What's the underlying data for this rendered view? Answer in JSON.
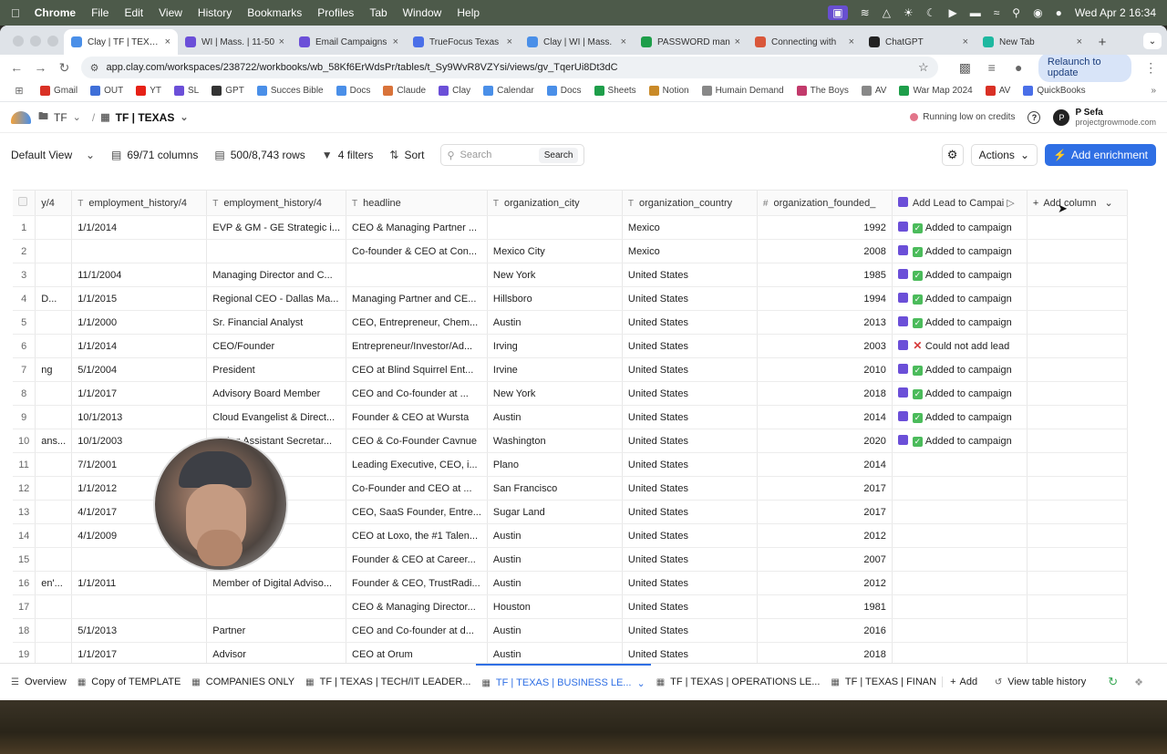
{
  "menubar": {
    "app": "Chrome",
    "items": [
      "File",
      "Edit",
      "View",
      "History",
      "Bookmarks",
      "Profiles",
      "Tab",
      "Window",
      "Help"
    ],
    "clock": "Wed Apr 2  16:34"
  },
  "browser": {
    "tabs": [
      {
        "label": "Clay | TF | TEXAS",
        "color": "#4a8fe8",
        "active": true
      },
      {
        "label": "WI | Mass. | 11-50",
        "color": "#6b4fd8"
      },
      {
        "label": "Email Campaigns",
        "color": "#6b4fd8"
      },
      {
        "label": "TrueFocus Texas",
        "color": "#4a6fe8"
      },
      {
        "label": "Clay | WI | Mass.",
        "color": "#4a8fe8"
      },
      {
        "label": "PASSWORD man",
        "color": "#1e9e4a"
      },
      {
        "label": "Connecting with",
        "color": "#d9573a"
      },
      {
        "label": "ChatGPT",
        "color": "#222222"
      },
      {
        "label": "New Tab",
        "color": "#1eb8a0"
      }
    ],
    "url": "app.clay.com/workspaces/238722/workbooks/wb_58Kf6ErWdsPr/tables/t_Sy9WvR8VZYsi/views/gv_TqerUi8Dt3dC",
    "relaunch": "Relaunch to update",
    "bookmarks": [
      {
        "label": "Gmail",
        "color": "#d93025"
      },
      {
        "label": "OUT",
        "color": "#3f6fd8"
      },
      {
        "label": "YT",
        "color": "#e62117"
      },
      {
        "label": "SL",
        "color": "#6b4fd8"
      },
      {
        "label": "GPT",
        "color": "#333333"
      },
      {
        "label": "Succes Bible",
        "color": "#4a8fe8"
      },
      {
        "label": "Docs",
        "color": "#4a8fe8"
      },
      {
        "label": "Claude",
        "color": "#d9733a"
      },
      {
        "label": "Clay",
        "color": "#6b4fd8"
      },
      {
        "label": "Calendar",
        "color": "#4a8fe8"
      },
      {
        "label": "Docs",
        "color": "#4a8fe8"
      },
      {
        "label": "Sheets",
        "color": "#1e9e4a"
      },
      {
        "label": "Notion",
        "color": "#c98a28"
      },
      {
        "label": "Humain Demand",
        "color": "#888888"
      },
      {
        "label": "The Boys",
        "color": "#c23a6b"
      },
      {
        "label": "AV",
        "color": "#888888"
      },
      {
        "label": "War Map 2024",
        "color": "#1e9e4a"
      },
      {
        "label": "AV",
        "color": "#d93025"
      },
      {
        "label": "QuickBooks",
        "color": "#4a6fe8"
      }
    ]
  },
  "clay": {
    "workspace": "TF",
    "table": "TF | TEXAS",
    "credits": "Running low on credits",
    "user_initials": "P",
    "user_name": "P Sefa",
    "user_org": "projectgrowmode.com",
    "view": "Default View",
    "columns": "69/71 columns",
    "rows": "500/8,743 rows",
    "filters": "4 filters",
    "sort": "Sort",
    "search_placeholder": "Search",
    "search_button": "Search",
    "actions": "Actions",
    "add_enrichment": "Add enrichment"
  },
  "grid": {
    "headers": [
      "y/4",
      "employment_history/4",
      "employment_history/4",
      "headline",
      "organization_city",
      "organization_country",
      "organization_founded_",
      "Add Lead to Campai",
      "Add column"
    ],
    "rows": [
      {
        "n": "1",
        "c0": "",
        "c1": "1/1/2014",
        "c2": "EVP & GM - GE Strategic i...",
        "c3": "CEO & Managing Partner ...",
        "c4": "",
        "c5": "Mexico",
        "c6": "1992",
        "c7": "Added to campaign",
        "s": "ok"
      },
      {
        "n": "2",
        "c0": "",
        "c1": "",
        "c2": "",
        "c3": "Co-founder & CEO at Con...",
        "c4": "Mexico City",
        "c5": "Mexico",
        "c6": "2008",
        "c7": "Added to campaign",
        "s": "ok"
      },
      {
        "n": "3",
        "c0": "",
        "c1": "11/1/2004",
        "c2": "Managing Director and C...",
        "c3": "",
        "c4": "New York",
        "c5": "United States",
        "c6": "1985",
        "c7": "Added to campaign",
        "s": "ok"
      },
      {
        "n": "4",
        "c0": "D...",
        "c1": "1/1/2015",
        "c2": "Regional CEO - Dallas Ma...",
        "c3": "Managing Partner and CE...",
        "c4": "Hillsboro",
        "c5": "United States",
        "c6": "1994",
        "c7": "Added to campaign",
        "s": "ok"
      },
      {
        "n": "5",
        "c0": "",
        "c1": "1/1/2000",
        "c2": "Sr. Financial Analyst",
        "c3": "CEO, Entrepreneur, Chem...",
        "c4": "Austin",
        "c5": "United States",
        "c6": "2013",
        "c7": "Added to campaign",
        "s": "ok"
      },
      {
        "n": "6",
        "c0": "",
        "c1": "1/1/2014",
        "c2": "CEO/Founder",
        "c3": "Entrepreneur/Investor/Ad...",
        "c4": "Irving",
        "c5": "United States",
        "c6": "2003",
        "c7": "Could not add lead",
        "s": "fail"
      },
      {
        "n": "7",
        "c0": "ng",
        "c1": "5/1/2004",
        "c2": "President",
        "c3": "CEO at Blind Squirrel Ent...",
        "c4": "Irvine",
        "c5": "United States",
        "c6": "2010",
        "c7": "Added to campaign",
        "s": "ok"
      },
      {
        "n": "8",
        "c0": "",
        "c1": "1/1/2017",
        "c2": "Advisory Board Member",
        "c3": "CEO and Co-founder at ...",
        "c4": "New York",
        "c5": "United States",
        "c6": "2018",
        "c7": "Added to campaign",
        "s": "ok"
      },
      {
        "n": "9",
        "c0": "",
        "c1": "10/1/2013",
        "c2": "Cloud Evangelist & Direct...",
        "c3": "Founder & CEO at Wursta",
        "c4": "Austin",
        "c5": "United States",
        "c6": "2014",
        "c7": "Added to campaign",
        "s": "ok"
      },
      {
        "n": "10",
        "c0": "ans...",
        "c1": "10/1/2003",
        "c2": "Acting Assistant Secretar...",
        "c3": "CEO & Co-Founder Cavnue",
        "c4": "Washington",
        "c5": "United States",
        "c6": "2020",
        "c7": "Added to campaign",
        "s": "ok"
      },
      {
        "n": "11",
        "c0": "",
        "c1": "7/1/2001",
        "c2": "ent and COO",
        "c3": "Leading Executive, CEO, i...",
        "c4": "Plano",
        "c5": "United States",
        "c6": "2014",
        "c7": "",
        "s": ""
      },
      {
        "n": "12",
        "c0": "",
        "c1": "1/1/2012",
        "c2": "nce Intern",
        "c3": "Co-Founder and CEO at ...",
        "c4": "San Francisco",
        "c5": "United States",
        "c6": "2017",
        "c7": "",
        "s": ""
      },
      {
        "n": "13",
        "c0": "",
        "c1": "4/1/2017",
        "c2": "ur & Investor",
        "c3": "CEO, SaaS Founder, Entre...",
        "c4": "Sugar Land",
        "c5": "United States",
        "c6": "2017",
        "c7": "",
        "s": ""
      },
      {
        "n": "14",
        "c0": "",
        "c1": "4/1/2009",
        "c2": "Of Operations",
        "c3": "CEO at Loxo, the #1 Talen...",
        "c4": "Austin",
        "c5": "United States",
        "c6": "2012",
        "c7": "",
        "s": ""
      },
      {
        "n": "15",
        "c0": "",
        "c1": "",
        "c2": "",
        "c3": "Founder & CEO at Career...",
        "c4": "Austin",
        "c5": "United States",
        "c6": "2007",
        "c7": "",
        "s": ""
      },
      {
        "n": "16",
        "c0": "en'...",
        "c1": "1/1/2011",
        "c2": "Member of Digital Adviso...",
        "c3": "Founder & CEO, TrustRadi...",
        "c4": "Austin",
        "c5": "United States",
        "c6": "2012",
        "c7": "",
        "s": ""
      },
      {
        "n": "17",
        "c0": "",
        "c1": "",
        "c2": "",
        "c3": "CEO & Managing Director...",
        "c4": "Houston",
        "c5": "United States",
        "c6": "1981",
        "c7": "",
        "s": ""
      },
      {
        "n": "18",
        "c0": "",
        "c1": "5/1/2013",
        "c2": "Partner",
        "c3": "CEO and Co-founder at d...",
        "c4": "Austin",
        "c5": "United States",
        "c6": "2016",
        "c7": "",
        "s": ""
      },
      {
        "n": "19",
        "c0": "",
        "c1": "1/1/2017",
        "c2": "Advisor",
        "c3": "CEO at Orum",
        "c4": "Austin",
        "c5": "United States",
        "c6": "2018",
        "c7": "",
        "s": ""
      }
    ]
  },
  "bottom": {
    "tabs": [
      "Overview",
      "Copy of TEMPLATE",
      "COMPANIES ONLY",
      "TF | TEXAS | TECH/IT LEADER...",
      "TF | TEXAS | BUSINESS LE...",
      "TF | TEXAS | OPERATIONS LE...",
      "TF | TEXAS | FINAN"
    ],
    "active_index": 4,
    "add": "Add",
    "history": "View table history"
  }
}
